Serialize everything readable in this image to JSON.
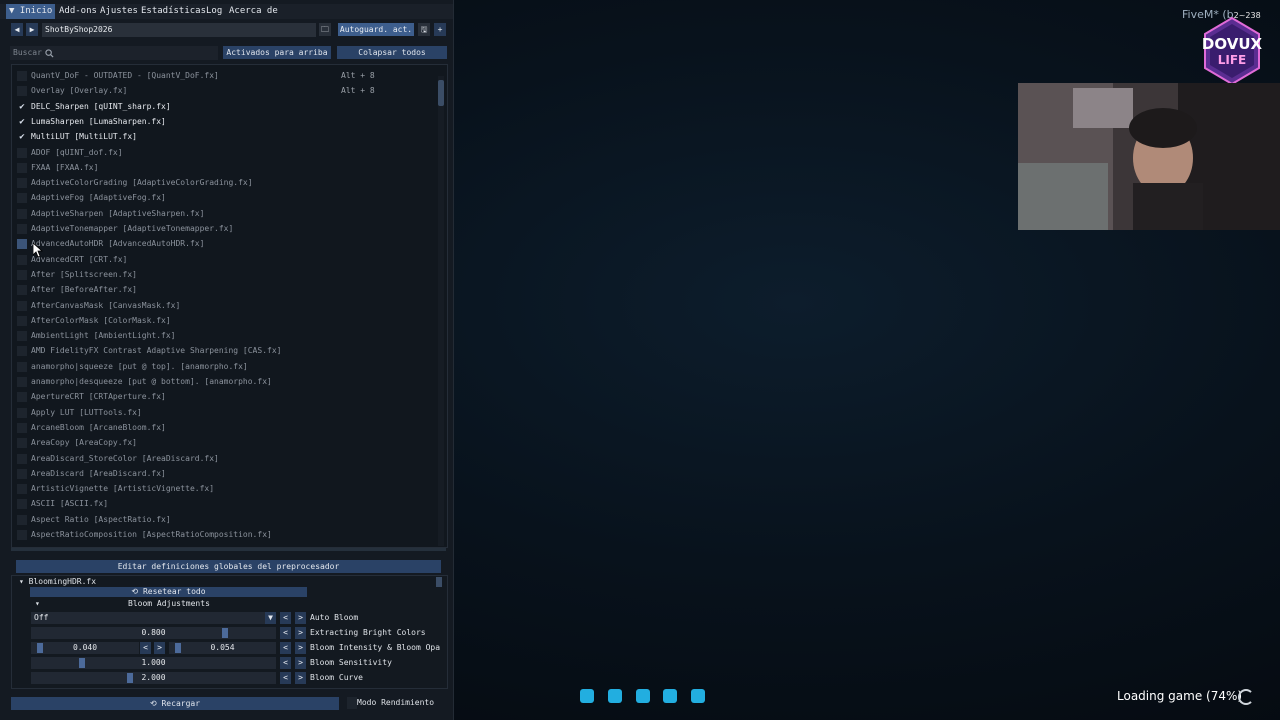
{
  "menu": {
    "items": [
      "▼ Inicio",
      "Add-ons",
      "Ajustes",
      "Estadísticas",
      "Log",
      "Acerca de"
    ]
  },
  "preset": {
    "name": "ShotByShop2026",
    "autosave": "Autoguard. act.",
    "prev": "◀",
    "next": "▶",
    "folder": "🗀",
    "save": "🖫",
    "add": "+"
  },
  "search": {
    "placeholder": "Buscar",
    "icon": "search-icon",
    "active_top": "Activados para arriba",
    "collapse": "Colapsar todos"
  },
  "effects": [
    {
      "label": "QuantV_DoF - OUTDATED - [QuantV_DoF.fx]",
      "checked": false,
      "hotkey": "Alt + 8"
    },
    {
      "label": "Overlay [Overlay.fx]",
      "checked": false,
      "hotkey": "Alt + 8"
    },
    {
      "label": "DELC_Sharpen [qUINT_sharp.fx]",
      "checked": true,
      "hotkey": ""
    },
    {
      "label": "LumaSharpen [LumaSharpen.fx]",
      "checked": true,
      "hotkey": ""
    },
    {
      "label": "MultiLUT [MultiLUT.fx]",
      "checked": true,
      "hotkey": ""
    },
    {
      "label": "ADOF [qUINT_dof.fx]",
      "checked": false,
      "hotkey": ""
    },
    {
      "label": "FXAA [FXAA.fx]",
      "checked": false,
      "hotkey": ""
    },
    {
      "label": "AdaptiveColorGrading [AdaptiveColorGrading.fx]",
      "checked": false,
      "hotkey": ""
    },
    {
      "label": "AdaptiveFog [AdaptiveFog.fx]",
      "checked": false,
      "hotkey": ""
    },
    {
      "label": "AdaptiveSharpen [AdaptiveSharpen.fx]",
      "checked": false,
      "hotkey": ""
    },
    {
      "label": "AdaptiveTonemapper [AdaptiveTonemapper.fx]",
      "checked": false,
      "hotkey": ""
    },
    {
      "label": "AdvancedAutoHDR [AdvancedAutoHDR.fx]",
      "checked": false,
      "hotkey": "",
      "hover": true
    },
    {
      "label": "AdvancedCRT [CRT.fx]",
      "checked": false,
      "hotkey": ""
    },
    {
      "label": "After [Splitscreen.fx]",
      "checked": false,
      "hotkey": ""
    },
    {
      "label": "After [BeforeAfter.fx]",
      "checked": false,
      "hotkey": ""
    },
    {
      "label": "AfterCanvasMask [CanvasMask.fx]",
      "checked": false,
      "hotkey": ""
    },
    {
      "label": "AfterColorMask [ColorMask.fx]",
      "checked": false,
      "hotkey": ""
    },
    {
      "label": "AmbientLight [AmbientLight.fx]",
      "checked": false,
      "hotkey": ""
    },
    {
      "label": "AMD FidelityFX Contrast Adaptive Sharpening [CAS.fx]",
      "checked": false,
      "hotkey": ""
    },
    {
      "label": "anamorpho|squeeze [put @ top]. [anamorpho.fx]",
      "checked": false,
      "hotkey": ""
    },
    {
      "label": "anamorpho|desqueeze [put @ bottom]. [anamorpho.fx]",
      "checked": false,
      "hotkey": ""
    },
    {
      "label": "ApertureCRT [CRTAperture.fx]",
      "checked": false,
      "hotkey": ""
    },
    {
      "label": "Apply LUT [LUTTools.fx]",
      "checked": false,
      "hotkey": ""
    },
    {
      "label": "ArcaneBloom [ArcaneBloom.fx]",
      "checked": false,
      "hotkey": ""
    },
    {
      "label": "AreaCopy [AreaCopy.fx]",
      "checked": false,
      "hotkey": ""
    },
    {
      "label": "AreaDiscard_StoreColor [AreaDiscard.fx]",
      "checked": false,
      "hotkey": ""
    },
    {
      "label": "AreaDiscard [AreaDiscard.fx]",
      "checked": false,
      "hotkey": ""
    },
    {
      "label": "ArtisticVignette [ArtisticVignette.fx]",
      "checked": false,
      "hotkey": ""
    },
    {
      "label": "ASCII [ASCII.fx]",
      "checked": false,
      "hotkey": ""
    },
    {
      "label": "Aspect Ratio [AspectRatio.fx]",
      "checked": false,
      "hotkey": ""
    },
    {
      "label": "AspectRatioComposition [AspectRatioComposition.fx]",
      "checked": false,
      "hotkey": ""
    }
  ],
  "global_defs": "Editar definiciones globales del preprocesador",
  "effect_section": {
    "file": "▾ BloomingHDR.fx",
    "reset": "⟲ Resetear todo",
    "category": "▾",
    "category_title": "Bloom Adjustments",
    "params": [
      {
        "name": "Auto Bloom",
        "value": "Off",
        "kind": "combo"
      },
      {
        "name": "Extracting Bright Colors",
        "value": "0.800",
        "kind": "slider",
        "level": 0.8
      },
      {
        "name": "Bloom Intensity & Bloom Opa",
        "value": "0.040",
        "value2": "0.054",
        "kind": "double"
      },
      {
        "name": "Bloom Sensitivity",
        "value": "1.000",
        "kind": "slider",
        "level": 0.2
      },
      {
        "name": "Bloom Curve",
        "value": "2.000",
        "kind": "slider",
        "level": 0.4
      }
    ],
    "arrow_left": "<",
    "arrow_right": ">",
    "combo_arrow": "▼"
  },
  "footer": {
    "reload": "⟲ Recargar",
    "perf_mode": "Modo Rendimiento"
  },
  "overlay": {
    "fivem": "FiveM* (b",
    "fivem_build": "2~238",
    "logo_top": "DOVUX",
    "logo_bottom": "LIFE",
    "social_icons": [
      "twitch-icon",
      "instagram-icon",
      "tiktok-icon",
      "twitter-icon",
      "youtube-icon"
    ],
    "loading": "Loading game (74%)"
  }
}
